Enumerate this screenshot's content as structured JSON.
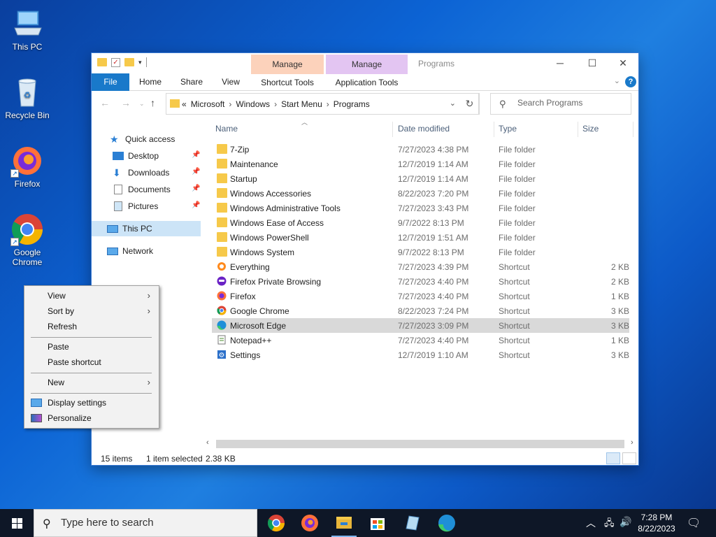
{
  "desktop": {
    "icons": [
      {
        "label": "This PC"
      },
      {
        "label": "Recycle Bin"
      },
      {
        "label": "Firefox"
      },
      {
        "label": "Google Chrome"
      }
    ]
  },
  "explorer": {
    "title": "Programs",
    "context_tabs": [
      {
        "group": "Manage",
        "tab": "Shortcut Tools",
        "color": "#fcd2bb"
      },
      {
        "group": "Manage",
        "tab": "Application Tools",
        "color": "#e3c5f2"
      }
    ],
    "ribbon_tabs": [
      "File",
      "Home",
      "Share",
      "View"
    ],
    "breadcrumbs": [
      "«",
      "Microsoft",
      "Windows",
      "Start Menu",
      "Programs"
    ],
    "search_placeholder": "Search Programs",
    "nav": {
      "quick_access": "Quick access",
      "items": [
        "Desktop",
        "Downloads",
        "Documents",
        "Pictures"
      ],
      "this_pc": "This PC",
      "network": "Network"
    },
    "columns": {
      "name": "Name",
      "date": "Date modified",
      "type": "Type",
      "size": "Size"
    },
    "files": [
      {
        "name": "7-Zip",
        "date": "7/27/2023 4:38 PM",
        "type": "File folder",
        "size": "",
        "icon": "folder"
      },
      {
        "name": "Maintenance",
        "date": "12/7/2019 1:14 AM",
        "type": "File folder",
        "size": "",
        "icon": "folder"
      },
      {
        "name": "Startup",
        "date": "12/7/2019 1:14 AM",
        "type": "File folder",
        "size": "",
        "icon": "folder"
      },
      {
        "name": "Windows Accessories",
        "date": "8/22/2023 7:20 PM",
        "type": "File folder",
        "size": "",
        "icon": "folder"
      },
      {
        "name": "Windows Administrative Tools",
        "date": "7/27/2023 3:43 PM",
        "type": "File folder",
        "size": "",
        "icon": "folder"
      },
      {
        "name": "Windows Ease of Access",
        "date": "9/7/2022 8:13 PM",
        "type": "File folder",
        "size": "",
        "icon": "folder"
      },
      {
        "name": "Windows PowerShell",
        "date": "12/7/2019 1:51 AM",
        "type": "File folder",
        "size": "",
        "icon": "folder"
      },
      {
        "name": "Windows System",
        "date": "9/7/2022 8:13 PM",
        "type": "File folder",
        "size": "",
        "icon": "folder"
      },
      {
        "name": "Everything",
        "date": "7/27/2023 4:39 PM",
        "type": "Shortcut",
        "size": "2 KB",
        "icon": "everything"
      },
      {
        "name": "Firefox Private Browsing",
        "date": "7/27/2023 4:40 PM",
        "type": "Shortcut",
        "size": "2 KB",
        "icon": "firefox-private"
      },
      {
        "name": "Firefox",
        "date": "7/27/2023 4:40 PM",
        "type": "Shortcut",
        "size": "1 KB",
        "icon": "firefox"
      },
      {
        "name": "Google Chrome",
        "date": "8/22/2023 7:24 PM",
        "type": "Shortcut",
        "size": "3 KB",
        "icon": "chrome"
      },
      {
        "name": "Microsoft Edge",
        "date": "7/27/2023 3:09 PM",
        "type": "Shortcut",
        "size": "3 KB",
        "icon": "edge",
        "selected": true
      },
      {
        "name": "Notepad++",
        "date": "7/27/2023 4:40 PM",
        "type": "Shortcut",
        "size": "1 KB",
        "icon": "notepadpp"
      },
      {
        "name": "Settings",
        "date": "12/7/2019 1:10 AM",
        "type": "Shortcut",
        "size": "3 KB",
        "icon": "settings"
      }
    ],
    "status": {
      "count": "15 items",
      "selected": "1 item selected",
      "size": "2.38 KB"
    }
  },
  "context_menu": {
    "view": "View",
    "sort_by": "Sort by",
    "refresh": "Refresh",
    "paste": "Paste",
    "paste_shortcut": "Paste shortcut",
    "new": "New",
    "display_settings": "Display settings",
    "personalize": "Personalize"
  },
  "taskbar": {
    "search_placeholder": "Type here to search",
    "time": "7:28 PM",
    "date": "8/22/2023"
  }
}
